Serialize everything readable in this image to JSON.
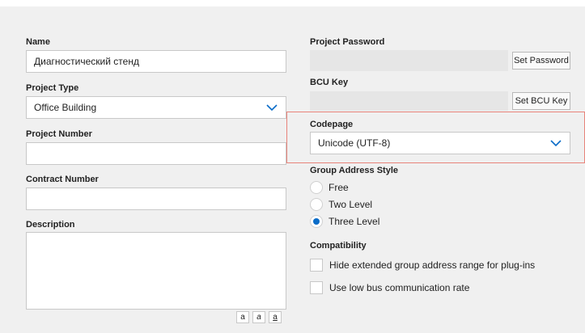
{
  "left": {
    "name": {
      "label": "Name",
      "value": "Диагностический стенд"
    },
    "project_type": {
      "label": "Project Type",
      "value": "Office Building"
    },
    "project_number": {
      "label": "Project Number",
      "value": ""
    },
    "contract_number": {
      "label": "Contract Number",
      "value": ""
    },
    "description": {
      "label": "Description",
      "value": ""
    },
    "format_buttons": [
      "a",
      "a",
      "a"
    ]
  },
  "right": {
    "project_password": {
      "label": "Project Password",
      "button": "Set Password"
    },
    "bcu_key": {
      "label": "BCU Key",
      "button": "Set BCU Key"
    },
    "codepage": {
      "label": "Codepage",
      "value": "Unicode (UTF-8)"
    },
    "group_address_style": {
      "label": "Group Address Style",
      "options": [
        "Free",
        "Two Level",
        "Three Level"
      ],
      "selected": "Three Level"
    },
    "compatibility": {
      "label": "Compatibility",
      "options": [
        "Hide extended group address range for plug-ins",
        "Use low bus communication rate"
      ]
    }
  },
  "colors": {
    "accent": "#0a6cc8",
    "highlight": "#e8837a",
    "background": "#f0f0f0"
  }
}
